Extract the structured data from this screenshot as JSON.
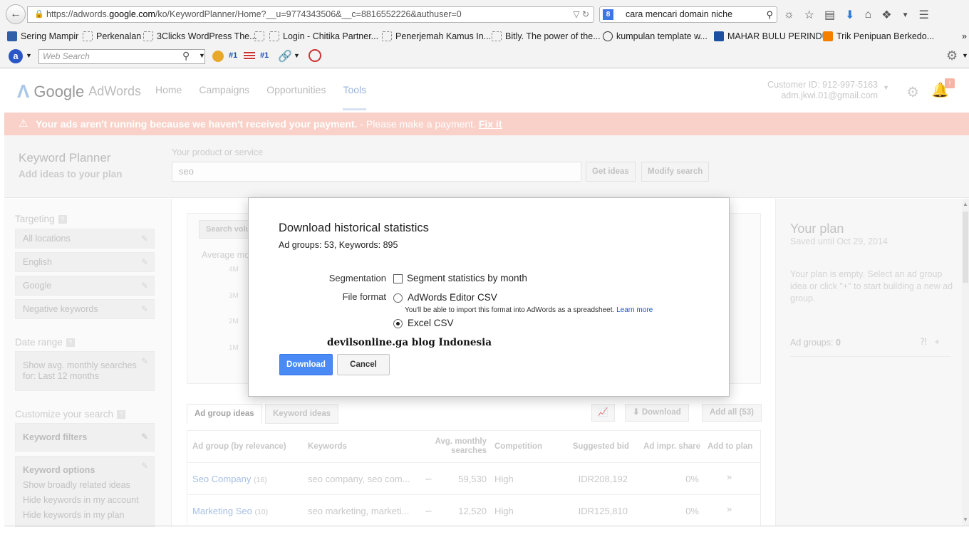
{
  "browser": {
    "url_prefix": "https://adwords.",
    "url_host": "google.com",
    "url_rest": "/ko/KeywordPlanner/Home?__u=9774343506&__c=8816552226&authuser=0",
    "search_engine_badge": "8",
    "search_query": "cara mencari domain niche",
    "bookmarks": [
      "Sering Mampir",
      "Perkenalan",
      "3Clicks WordPress The...",
      "",
      "Login - Chitika Partner...",
      "Penerjemah Kamus In...",
      "Bitly. The power of the...",
      "kumpulan template w...",
      "MAHAR BULU PERINDU",
      "Trik Penipuan Berkedo..."
    ],
    "web_search_placeholder": "Web Search",
    "addon_rank1": "#1",
    "addon_rank2": "#1"
  },
  "header": {
    "logo_google": "Google",
    "logo_adwords": "AdWords",
    "nav": [
      "Home",
      "Campaigns",
      "Opportunities",
      "Tools"
    ],
    "active_nav": "Tools",
    "customer_id": "Customer ID: 912-997-5163",
    "email": "adm.jkwi.01@gmail.com",
    "notification_count": "!"
  },
  "alert": {
    "bold": "Your ads aren't running because we haven't received your payment.",
    "text": " - Please make a payment. ",
    "link": "Fix it"
  },
  "planner": {
    "title": "Keyword Planner",
    "subtitle": "Add ideas to your plan",
    "product_label": "Your product or service",
    "product_value": "seo",
    "get_ideas": "Get ideas",
    "modify_search": "Modify search"
  },
  "sidebar": {
    "targeting": "Targeting",
    "targeting_items": [
      "All locations",
      "English",
      "Google",
      "Negative keywords"
    ],
    "date_range": "Date range",
    "date_line1": "Show avg. monthly searches",
    "date_line2": "for: Last 12 months",
    "customize": "Customize your search",
    "keyword_filters": "Keyword filters",
    "keyword_options": "Keyword options",
    "options": [
      "Show broadly related ideas",
      "Hide keywords in my account",
      "Hide keywords in my plan"
    ]
  },
  "chart": {
    "search_volume_btn": "Search volu",
    "avg_label": "Average mo",
    "yticks": [
      "4M",
      "3M",
      "2M",
      "1M"
    ]
  },
  "results": {
    "tab_adgroup": "Ad group ideas",
    "tab_keyword": "Keyword ideas",
    "download": "Download",
    "add_all": "Add all (53)",
    "columns": [
      "Ad group (by relevance)",
      "Keywords",
      "Avg. monthly searches",
      "Competition",
      "Suggested bid",
      "Ad impr. share",
      "Add to plan"
    ],
    "rows": [
      {
        "name": "Seo Company",
        "count": "(16)",
        "keywords": "seo company, seo com...",
        "searches": "59,530",
        "competition": "High",
        "bid": "IDR208,192",
        "share": "0%"
      },
      {
        "name": "Marketing Seo",
        "count": "(10)",
        "keywords": "seo marketing, marketi...",
        "searches": "12,520",
        "competition": "High",
        "bid": "IDR125,810",
        "share": "0%"
      }
    ]
  },
  "plan": {
    "title": "Your plan",
    "saved": "Saved until Oct 29, 2014",
    "empty": "Your plan is empty. Select an ad group idea or click \"+\" to start building a new ad group.",
    "ad_groups_label": "Ad groups:",
    "ad_groups_value": "0"
  },
  "dialog": {
    "title": "Download historical statistics",
    "summary": "Ad groups: 53, Keywords: 895",
    "segmentation_label": "Segmentation",
    "segment_option": "Segment statistics by month",
    "segment_checked": false,
    "file_format_label": "File format",
    "option_editor": "AdWords Editor CSV",
    "editor_hint": "You'll be able to import this format into AdWords as a spreadsheet.",
    "learn_more": "Learn more",
    "option_excel": "Excel CSV",
    "selected_format": "Excel CSV",
    "watermark": "devilsonline.ga blog Indonesia",
    "download_btn": "Download",
    "cancel_btn": "Cancel"
  },
  "colors": {
    "alert_bg": "#f9d1c8",
    "primary_button": "#4a8af4",
    "link": "#1155cc"
  }
}
